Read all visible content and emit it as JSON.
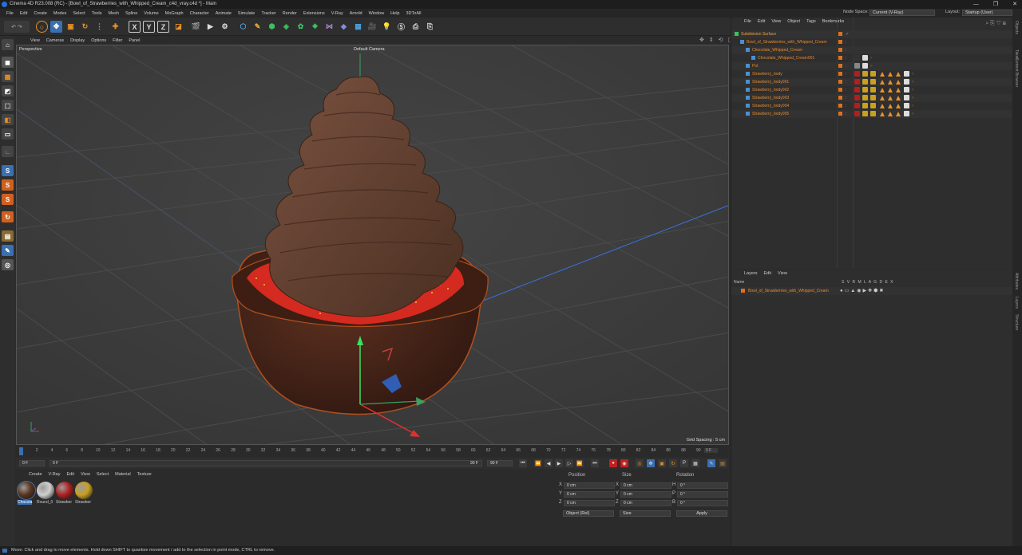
{
  "title": "Cinema 4D R23.008 (RC) - [Bowl_of_Strawberries_with_Whipped_Cream_c4d_vray.c4d *] - Main",
  "menu": [
    "File",
    "Edit",
    "Create",
    "Modes",
    "Select",
    "Tools",
    "Mesh",
    "Spline",
    "Volume",
    "MoGraph",
    "Character",
    "Animate",
    "Simulate",
    "Tracker",
    "Render",
    "Extensions",
    "V-Ray",
    "Arnold",
    "Window",
    "Help",
    "3DToAll"
  ],
  "node_space_label": "Node Space:",
  "node_space_value": "Current (V-Ray)",
  "layout_label": "Layout:",
  "layout_value": "Startup (User)",
  "viewport_menu": [
    "View",
    "Cameras",
    "Display",
    "Options",
    "Filter",
    "Panel"
  ],
  "viewport_label": "Perspective",
  "camera_label": "Default Camera",
  "grid_spacing": "Grid Spacing : 5 cm",
  "toolbar_axes": [
    "X",
    "Y",
    "Z"
  ],
  "obj_menu": [
    "File",
    "Edit",
    "View",
    "Object",
    "Tags",
    "Bookmarks"
  ],
  "objects": [
    {
      "name": "Subdivision Surface",
      "indent": 0
    },
    {
      "name": "Bowl_of_Strawberries_with_Whipped_Cream",
      "indent": 1
    },
    {
      "name": "Chocolate_Whipped_Cream",
      "indent": 2
    },
    {
      "name": "Chocolate_Whipped_Cream001",
      "indent": 3
    },
    {
      "name": "Pot",
      "indent": 2
    },
    {
      "name": "Strawberry_body",
      "indent": 2
    },
    {
      "name": "Strawberry_body001",
      "indent": 2
    },
    {
      "name": "Strawberry_body002",
      "indent": 2
    },
    {
      "name": "Strawberry_body003",
      "indent": 2
    },
    {
      "name": "Strawberry_body004",
      "indent": 2
    },
    {
      "name": "Strawberry_body005",
      "indent": 2
    }
  ],
  "layers_menu": [
    "Layers",
    "Edit",
    "View"
  ],
  "layers_header_name": "Name",
  "layers_header_cols": "S V R M L A G D E X",
  "layers": [
    "Bowl_of_Strawberries_with_Whipped_Cream"
  ],
  "side_tabs": [
    "Objects",
    "Takes",
    "Content Browser",
    "Attributes",
    "Layers",
    "Structure"
  ],
  "timeline_ticks": [
    "0",
    "2",
    "4",
    "6",
    "8",
    "10",
    "12",
    "14",
    "16",
    "18",
    "20",
    "22",
    "24",
    "26",
    "28",
    "30",
    "32",
    "34",
    "36",
    "38",
    "40",
    "42",
    "44",
    "46",
    "48",
    "50",
    "52",
    "54",
    "56",
    "58",
    "60",
    "62",
    "64",
    "66",
    "68",
    "70",
    "72",
    "74",
    "76",
    "78",
    "80",
    "82",
    "84",
    "86",
    "88",
    "90"
  ],
  "timeline_end": "0 F",
  "transport": {
    "start": "0 F",
    "min": "0 F",
    "max": "90 F",
    "end": "90 F"
  },
  "mat_menu": [
    "Create",
    "V-Ray",
    "Edit",
    "View",
    "Select",
    "Material",
    "Texture"
  ],
  "materials": [
    {
      "label": "Chocola",
      "color": "#5a3520"
    },
    {
      "label": "Round_0",
      "color": "#cfcfcf"
    },
    {
      "label": "Strawber",
      "color": "#b02020"
    },
    {
      "label": "Strawber",
      "color": "#c9a020"
    }
  ],
  "coords": {
    "headers": [
      "Position",
      "Size",
      "Rotation"
    ],
    "rows": [
      {
        "axis": "X",
        "pos": "0 cm",
        "saxis": "X",
        "size": "0 cm",
        "raxis": "H",
        "rot": "0 °"
      },
      {
        "axis": "Y",
        "pos": "0 cm",
        "saxis": "Y",
        "size": "0 cm",
        "raxis": "P",
        "rot": "0 °"
      },
      {
        "axis": "Z",
        "pos": "0 cm",
        "saxis": "Z",
        "size": "0 cm",
        "raxis": "B",
        "rot": "0 °"
      }
    ],
    "mode": "Object (Rel)",
    "size_mode": "Size",
    "apply": "Apply"
  },
  "status": "Move: Click and drag to move elements. Hold down SHIFT to quantize movement / add to the selection in point mode, CTRL to remove."
}
